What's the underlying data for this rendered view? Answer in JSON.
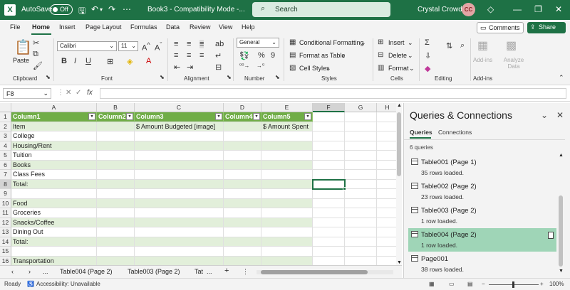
{
  "titlebar": {
    "autosave_label": "AutoSave",
    "autosave_state": "Off",
    "doc_title": "Book3 - Compatibility Mode -...",
    "search_placeholder": "Search",
    "user_name": "Crystal Crowder",
    "user_initials": "CC",
    "accent_color": "#1e7145"
  },
  "menu": [
    "File",
    "Home",
    "Insert",
    "Page Layout",
    "Formulas",
    "Data",
    "Review",
    "View",
    "Help"
  ],
  "menu_active": "Home",
  "comments_label": "Comments",
  "share_label": "Share",
  "ribbon": {
    "paste_label": "Paste",
    "font_name": "Calibri",
    "font_size": "11",
    "number_format": "General",
    "conditional_formatting": "Conditional Formatting",
    "format_as_table": "Format as Table",
    "cell_styles": "Cell Styles",
    "insert": "Insert",
    "delete": "Delete",
    "format": "Format",
    "addins_label": "Add-ins",
    "analyze_data_label": "Analyze Data",
    "groups": {
      "clipboard": "Clipboard",
      "font": "Font",
      "alignment": "Alignment",
      "number": "Number",
      "styles": "Styles",
      "cells": "Cells",
      "editing": "Editing",
      "addins": "Add-ins"
    }
  },
  "formula_bar": {
    "name_box": "F8",
    "formula": ""
  },
  "grid": {
    "columns": [
      "A",
      "B",
      "C",
      "D",
      "E",
      "F",
      "G",
      "H"
    ],
    "selected_column": "F",
    "selected_row": "8",
    "header_row": [
      "Column1",
      "Column2",
      "Column3",
      "Column4",
      "Column5"
    ],
    "rows": [
      {
        "num": "1"
      },
      {
        "num": "2",
        "a": "Item",
        "c": "$ Amount Budgeted [image]",
        "e": "$ Amount Spent"
      },
      {
        "num": "3",
        "a": "College"
      },
      {
        "num": "4",
        "a": "Housing/Rent"
      },
      {
        "num": "5",
        "a": "Tuition"
      },
      {
        "num": "6",
        "a": "Books"
      },
      {
        "num": "7",
        "a": "Class Fees"
      },
      {
        "num": "8",
        "a": "Total:"
      },
      {
        "num": "9",
        "a": ""
      },
      {
        "num": "10",
        "a": "Food"
      },
      {
        "num": "11",
        "a": "Groceries"
      },
      {
        "num": "12",
        "a": "Snacks/Coffee"
      },
      {
        "num": "13",
        "a": "Dining Out"
      },
      {
        "num": "14",
        "a": "Total:"
      },
      {
        "num": "15",
        "a": ""
      },
      {
        "num": "16",
        "a": "Transportation"
      }
    ]
  },
  "sheet_tabs": {
    "tabs": [
      "Table004 (Page 2)",
      "Table003 (Page 2)",
      "Tat"
    ],
    "more": "...",
    "add": "+"
  },
  "status": {
    "ready": "Ready",
    "accessibility": "Accessibility: Unavailable",
    "zoom": "100%"
  },
  "queries_pane": {
    "title": "Queries & Connections",
    "tab_queries": "Queries",
    "tab_connections": "Connections",
    "count": "6 queries",
    "items": [
      {
        "name": "Table001 (Page 1)",
        "status": "35 rows loaded."
      },
      {
        "name": "Table002 (Page 2)",
        "status": "23 rows loaded."
      },
      {
        "name": "Table003 (Page 2)",
        "status": "1 row loaded."
      },
      {
        "name": "Table004 (Page 2)",
        "status": "1 row loaded."
      },
      {
        "name": "Page001",
        "status": "38 rows loaded."
      }
    ],
    "selected_index": 3
  }
}
